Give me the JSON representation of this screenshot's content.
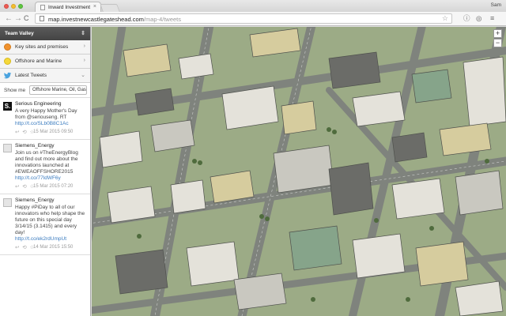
{
  "browser": {
    "tab_title": "Inward Investment",
    "tab_close": "×",
    "url_domain": "map.investnewcastlegateshead.com",
    "url_path": "/map-4/tweets",
    "user_name": "Sam",
    "back": "←",
    "forward": "→",
    "reload": "C",
    "bookmark_star": "☆",
    "info_icon": "ⓘ",
    "extension_icon": "◎",
    "menu_icon": "≡"
  },
  "sidebar": {
    "team_title": "Team Valley",
    "team_toggle": "⇕",
    "sections": [
      {
        "label": "Key sites and premises",
        "icon": "pin-icon",
        "chevron": "›"
      },
      {
        "label": "Offshore and Marine",
        "icon": "pin-icon",
        "chevron": "›"
      },
      {
        "label": "Latest Tweets",
        "icon": "twitter-icon",
        "chevron": "⌄"
      }
    ],
    "filter": {
      "label": "Show me",
      "value": "Offshore Marine, Oil, Gas"
    },
    "tweets": [
      {
        "author": "Serious Engineering",
        "avatar_letter": "S.",
        "text": "A very Happy Mother's Day from @seriouseng. RT",
        "link": "http://t.co/SLb0B8C1Ac",
        "time": "15 Mar 2015 09:50",
        "actions": "↩ ⟲ ☆"
      },
      {
        "author": "Siemens_Energy",
        "text": "Join us on #TheEnergyBlog and find out more about the innovations launched at #EWEAOFFSHORE2015",
        "link": "http://t.co/77ldWF6y",
        "time": "15 Mar 2015 07:20",
        "actions": "↩ ⟲ ☆"
      },
      {
        "author": "Siemens_Energy",
        "text": "Happy #PiDay to all of our innovators who help shape the future on this special day 3/14/15 (3.1415) and every day!",
        "link": "http://t.co/ek2rdUmpUt",
        "time": "14 Mar 2015 15:50",
        "actions": "↩ ⟲ ☆"
      }
    ]
  },
  "map": {
    "zoom_in": "+",
    "zoom_out": "−",
    "colors": {
      "grass": "#9cab86",
      "road": "#7f837d",
      "roof_light": "#e4e2da",
      "roof_dark": "#6b6c68",
      "roof_tan": "#d6cc9e",
      "roof_green": "#86a48a"
    }
  }
}
